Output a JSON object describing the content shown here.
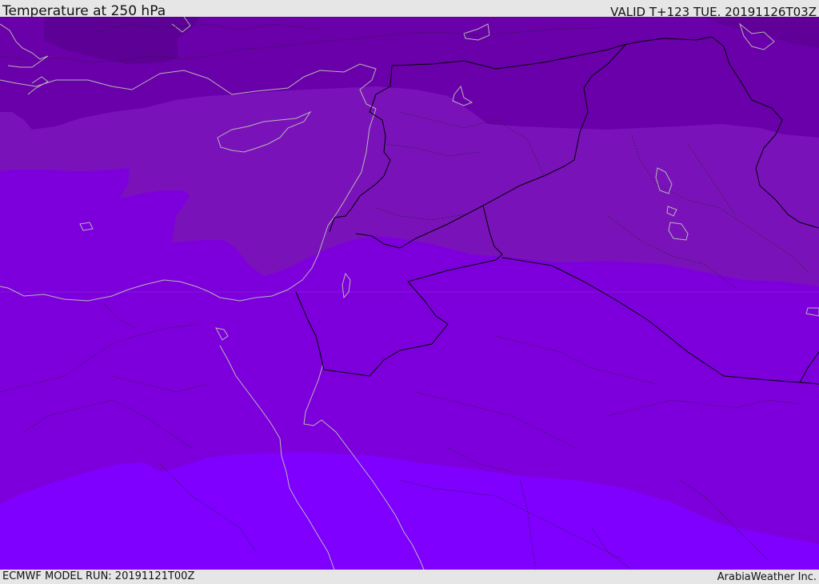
{
  "header": {
    "title": "Temperature at 250 hPa",
    "valid": "VALID T+123 TUE. 20191126T03Z"
  },
  "footer": {
    "model_run": "ECMWF MODEL RUN: 20191121T00Z",
    "credit": "ArabiaWeather Inc."
  },
  "colors": {
    "band_darkest": "#5c0096",
    "band_dark": "#6a00aa",
    "band_mid": "#7a12ba",
    "band_light": "#7d00dc",
    "band_lightest": "#7f00ff",
    "coastline": "#b5b5b5",
    "border": "#000000"
  }
}
